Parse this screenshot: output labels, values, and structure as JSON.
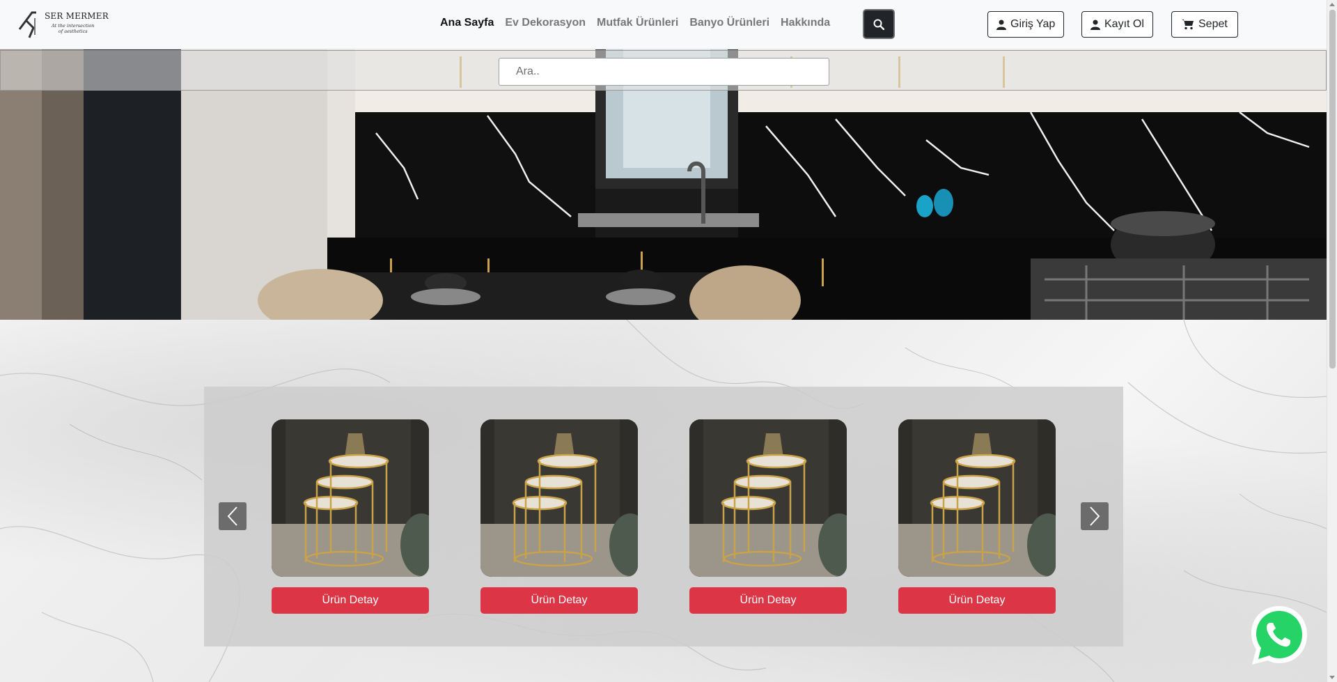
{
  "brand": {
    "name": "SER MERMER",
    "tagline_line1": "At the intersection",
    "tagline_line2": "of aesthetics"
  },
  "nav": {
    "items": [
      {
        "label": "Ana Sayfa",
        "active": true
      },
      {
        "label": "Ev Dekorasyon",
        "active": false
      },
      {
        "label": "Mutfak Ürünleri",
        "active": false
      },
      {
        "label": "Banyo Ürünleri",
        "active": false
      },
      {
        "label": "Hakkında",
        "active": false
      }
    ],
    "search_icon": "search-icon"
  },
  "auth": {
    "login_label": "Giriş Yap",
    "register_label": "Kayıt Ol",
    "cart_label": "Sepet"
  },
  "search": {
    "placeholder": "Ara.."
  },
  "carousel": {
    "products": [
      {
        "button_label": "Ürün Detay"
      },
      {
        "button_label": "Ürün Detay"
      },
      {
        "button_label": "Ürün Detay"
      },
      {
        "button_label": "Ürün Detay"
      }
    ],
    "prev_icon": "chevron-left-icon",
    "next_icon": "chevron-right-icon"
  },
  "colors": {
    "accent_red": "#dc3545",
    "dark": "#212529",
    "whatsapp_green": "#25d366"
  }
}
